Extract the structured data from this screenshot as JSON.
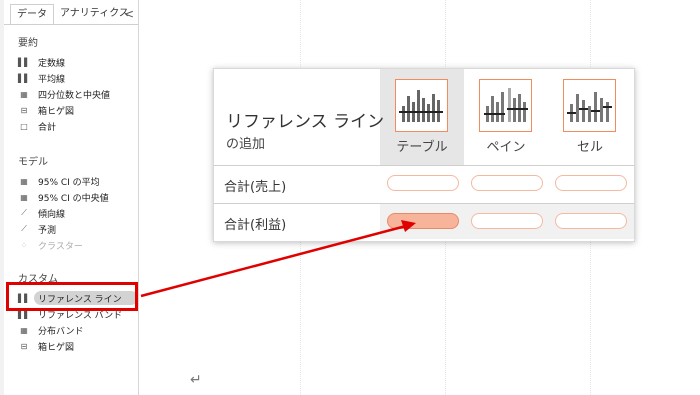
{
  "sidebar": {
    "tabs": {
      "data": "データ",
      "analytics": "アナリティクス",
      "collapse": "<"
    },
    "sections": {
      "summary": "要約",
      "model": "モデル",
      "custom": "カスタム"
    },
    "summary_items": [
      {
        "label": "定数線",
        "icon": "constant-line-icon"
      },
      {
        "label": "平均線",
        "icon": "average-line-icon"
      },
      {
        "label": "四分位数と中央値",
        "icon": "quartile-icon"
      },
      {
        "label": "箱ヒゲ図",
        "icon": "box-plot-icon"
      },
      {
        "label": "合計",
        "icon": "totals-icon"
      }
    ],
    "model_items": [
      {
        "label": "95% CI の平均",
        "icon": "ci-average-icon"
      },
      {
        "label": "95% CI の中央値",
        "icon": "ci-median-icon"
      },
      {
        "label": "傾向線",
        "icon": "trend-line-icon"
      },
      {
        "label": "予測",
        "icon": "forecast-icon"
      },
      {
        "label": "クラスター",
        "icon": "cluster-icon",
        "disabled": true
      }
    ],
    "custom_items": [
      {
        "label": "リファレンス ライン",
        "icon": "reference-line-icon",
        "selected": true
      },
      {
        "label": "リファレンス バンド",
        "icon": "reference-band-icon"
      },
      {
        "label": "分布バンド",
        "icon": "distribution-band-icon"
      },
      {
        "label": "箱ヒゲ図",
        "icon": "box-plot-icon"
      }
    ]
  },
  "popup": {
    "title": "リファレンス ライン",
    "subtitle": "の追加",
    "scopes": [
      "テーブル",
      "ペイン",
      "セル"
    ],
    "rows": [
      "合計(売上)",
      "合計(利益)"
    ],
    "active_target": {
      "row": "合計(利益)",
      "scope": "テーブル"
    }
  },
  "canvas": {
    "return_mark": "↵"
  },
  "colors": {
    "accent": "#f28c5c",
    "active_slot": "#f7b49a",
    "annotation": "#e00000"
  }
}
